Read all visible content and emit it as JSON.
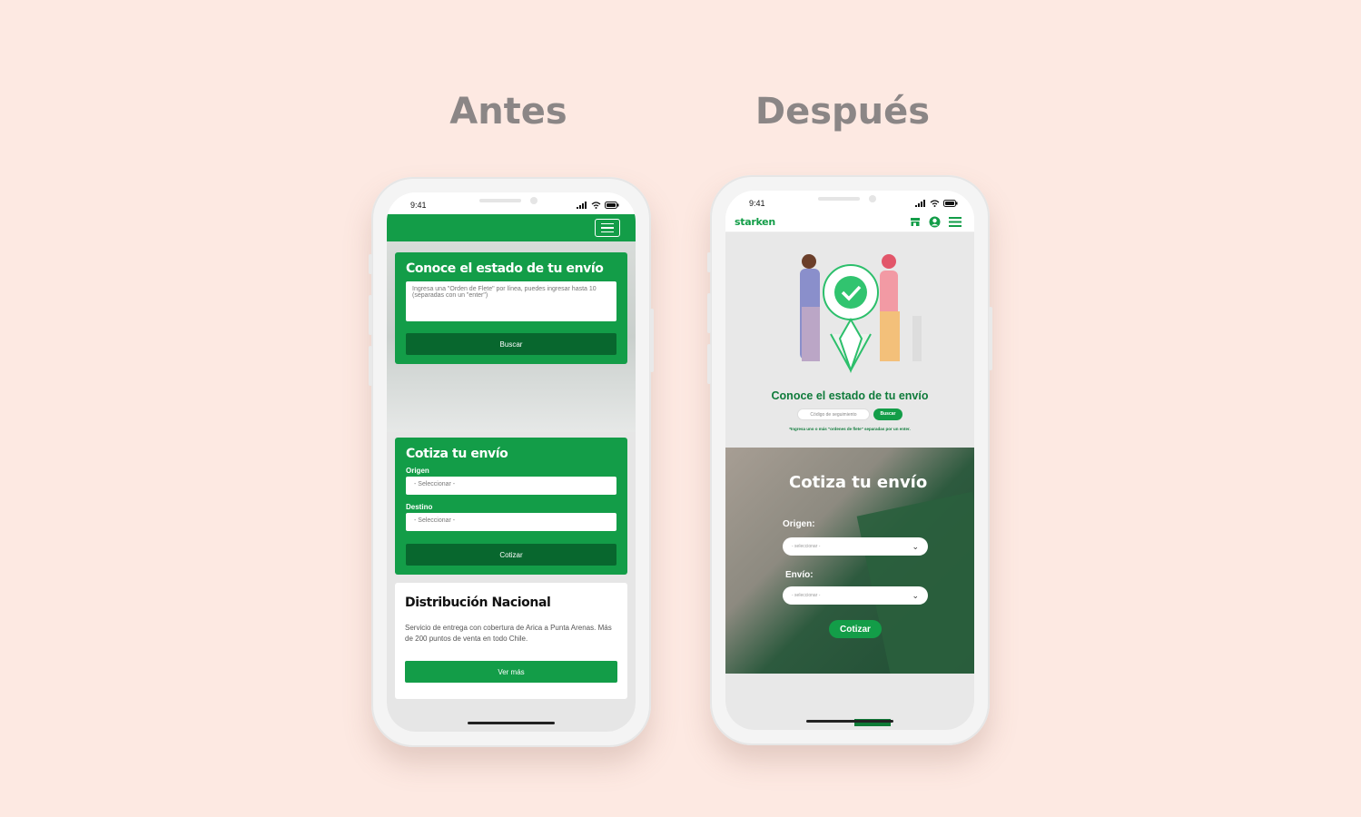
{
  "headings": {
    "before": "Antes",
    "after": "Después"
  },
  "status_time": "9:41",
  "before": {
    "tracking": {
      "title": "Conoce el estado de tu envío",
      "placeholder": "Ingresa una \"Orden de Flete\" por línea, puedes ingresar hasta 10 (separadas con un \"enter\")",
      "button": "Buscar"
    },
    "quote": {
      "title": "Cotiza tu envío",
      "origin_label": "Origen",
      "origin_value": "- Seleccionar -",
      "dest_label": "Destino",
      "dest_value": "- Seleccionar -",
      "button": "Cotizar"
    },
    "national": {
      "title": "Distribución Nacional",
      "text": "Servicio de entrega con cobertura de Arica a Punta Arenas. Más de 200 puntos de venta en todo Chile.",
      "button": "Ver más"
    }
  },
  "after": {
    "logo": "starken",
    "tracking": {
      "title": "Conoce el estado de tu envío",
      "placeholder": "Código de seguimiento",
      "button": "Buscar",
      "note": "*Ingresa uno o más \"ordenes de flete\" separadas por un enter."
    },
    "quote": {
      "title": "Cotiza tu envío",
      "origin_label": "Origen:",
      "origin_value": "- seleccionar -",
      "dest_label": "Envío:",
      "dest_value": "- seleccionar -",
      "button": "Cotizar"
    }
  },
  "colors": {
    "brand_green": "#139d48",
    "dark_green": "#08672e",
    "background": "#fde9e2"
  }
}
